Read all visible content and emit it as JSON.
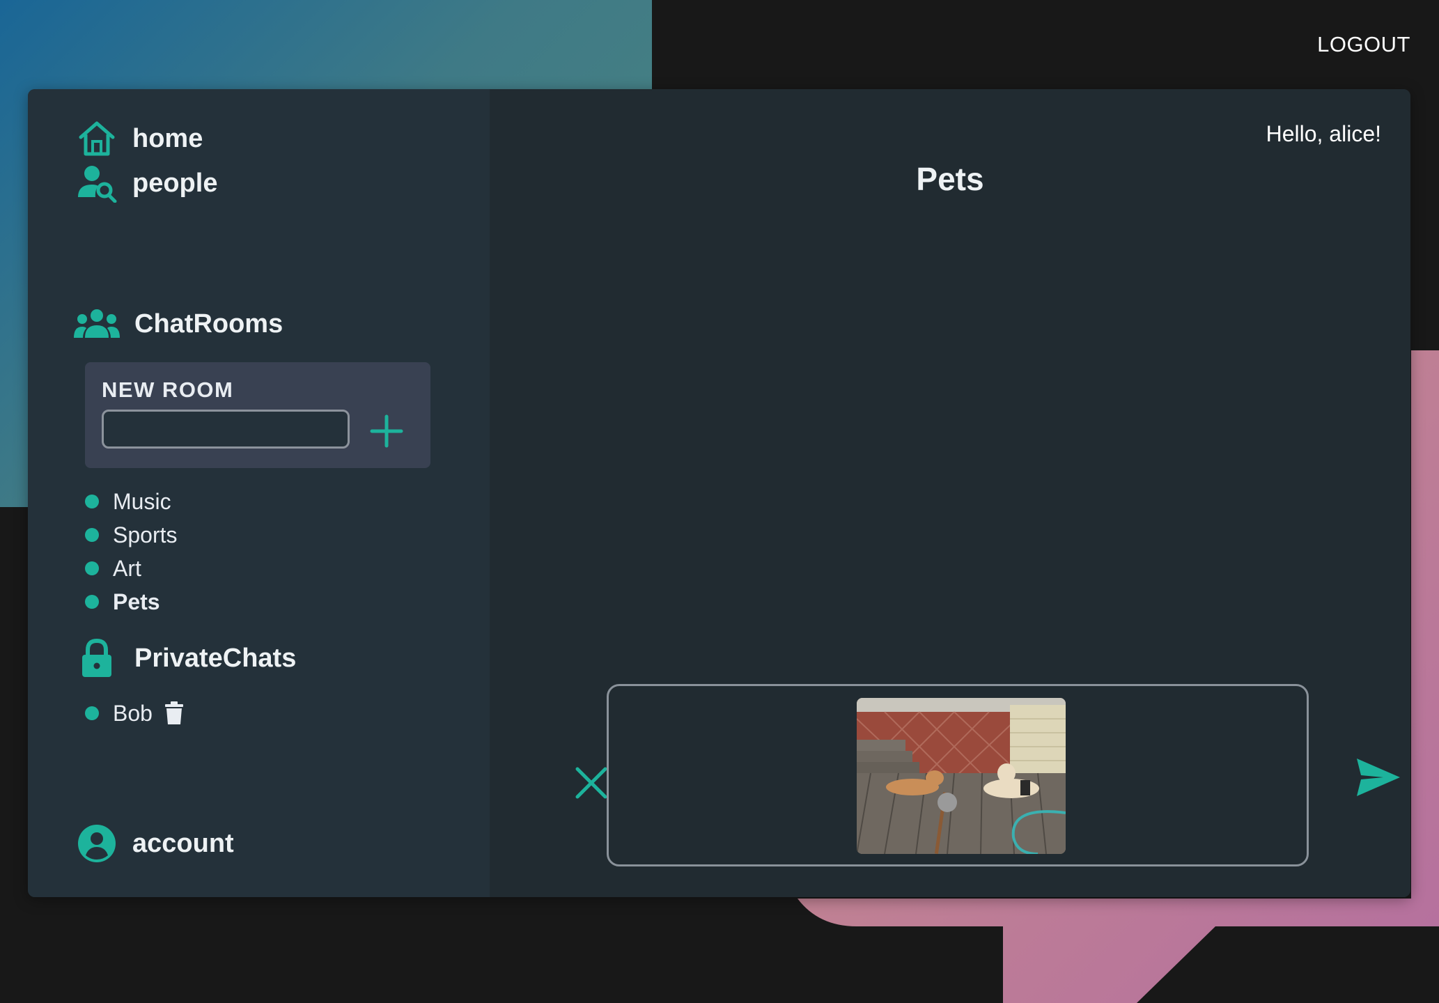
{
  "header": {
    "logout_label": "LOGOUT"
  },
  "nav": {
    "home_label": "home",
    "people_label": "people",
    "account_label": "account"
  },
  "chatrooms": {
    "title": "ChatRooms",
    "new_room_label": "NEW ROOM",
    "new_room_value": "",
    "rooms": [
      {
        "label": "Music",
        "active": false
      },
      {
        "label": "Sports",
        "active": false
      },
      {
        "label": "Art",
        "active": false
      },
      {
        "label": "Pets",
        "active": true
      }
    ]
  },
  "private_chats": {
    "title": "PrivateChats",
    "chats": [
      {
        "label": "Bob"
      }
    ]
  },
  "main": {
    "greeting": "Hello, alice!",
    "room_title": "Pets",
    "attachment": "photo-two-dogs-on-deck"
  },
  "icons": {
    "home": "home-icon",
    "people": "person-search-icon",
    "chatrooms": "group-icon",
    "add": "plus-icon",
    "private_chats": "lock-icon",
    "delete": "trash-icon",
    "account": "account-circle-icon",
    "cancel": "close-icon",
    "send": "send-icon"
  },
  "colors": {
    "accent": "#1db39c",
    "panel": "#212b31",
    "sidebar": "#24313a",
    "new_room_box": "#394152"
  }
}
